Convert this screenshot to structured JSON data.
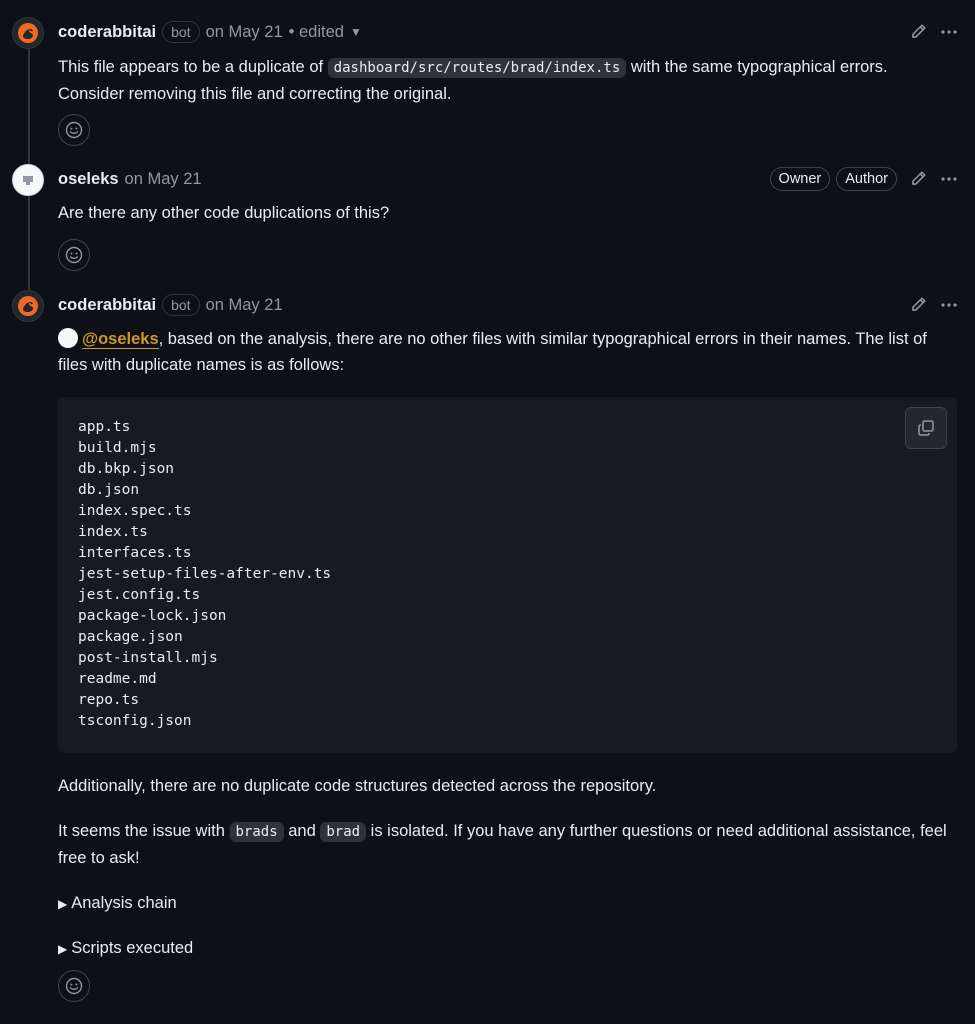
{
  "comments": [
    {
      "author": "coderabbitai",
      "badge": "bot",
      "meta": "on May 21",
      "edited": "• edited",
      "body_parts": {
        "pre": "This file appears to be a duplicate of ",
        "code": "dashboard/src/routes/brad/index.ts",
        "post": " with the same typographical errors. Consider removing this file and correcting the original."
      }
    },
    {
      "author": "oseleks",
      "meta": "on May 21",
      "roles": [
        "Owner",
        "Author"
      ],
      "body": "Are there any other code duplications of this?"
    },
    {
      "author": "coderabbitai",
      "badge": "bot",
      "meta": "on May 21",
      "mention": "@oseleks",
      "intro": ", based on the analysis, there are no other files with similar typographical errors in their names. The list of files with duplicate names is as follows:",
      "files": [
        "app.ts",
        "build.mjs",
        "db.bkp.json",
        "db.json",
        "index.spec.ts",
        "index.ts",
        "interfaces.ts",
        "jest-setup-files-after-env.ts",
        "jest.config.ts",
        "package-lock.json",
        "package.json",
        "post-install.mjs",
        "readme.md",
        "repo.ts",
        "tsconfig.json"
      ],
      "para1": "Additionally, there are no duplicate code structures detected across the repository.",
      "para2": {
        "pre": "It seems the issue with ",
        "code1": "brads",
        "mid": " and ",
        "code2": "brad",
        "post": " is isolated. If you have any further questions or need additional assistance, feel free to ask!"
      },
      "details": [
        "Analysis chain",
        "Scripts executed"
      ]
    }
  ],
  "icons": {
    "avatar_bot": "rabbit-icon",
    "avatar_user": "user-avatar",
    "edit": "pencil-icon",
    "more": "kebab-icon",
    "reaction": "smiley-icon",
    "copy": "copy-icon",
    "details": "triangle-right-icon"
  },
  "colors": {
    "background": "#0d1117",
    "text": "#e6edf3",
    "muted": "#9198a1",
    "mention": "#d29922",
    "code_bg": "#151b23",
    "brand": "#f26a21"
  }
}
